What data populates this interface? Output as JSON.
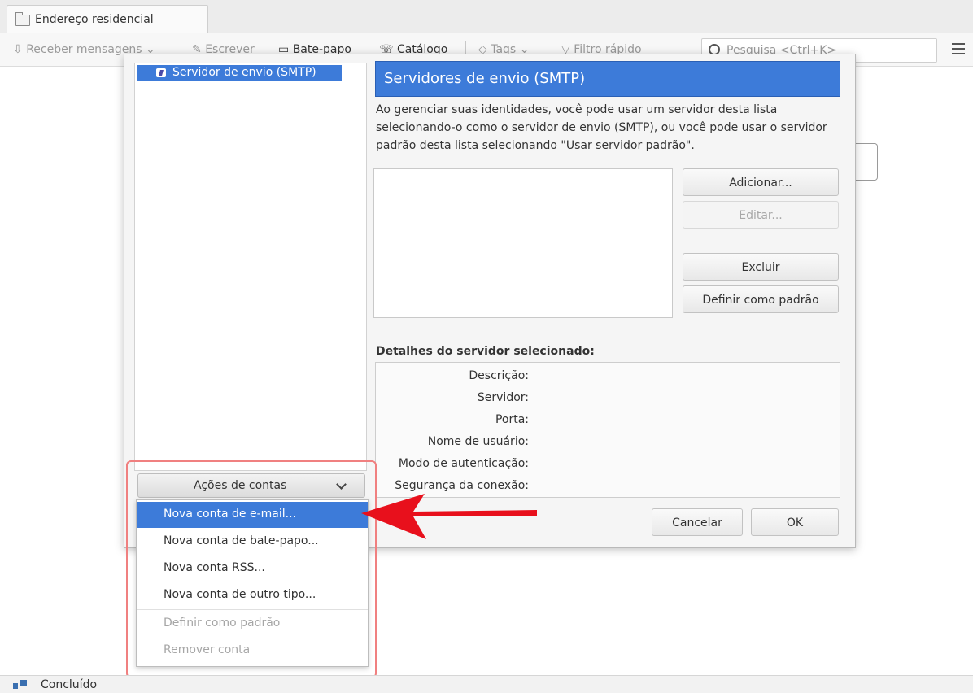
{
  "tab": {
    "title": "Endereço residencial"
  },
  "toolbar": {
    "get_messages": "Receber mensagens",
    "compose": "Escrever",
    "chat": "Bate-papo",
    "address_book": "Catálogo",
    "tags": "Tags",
    "quick_filter": "Filtro rápido",
    "search_placeholder": "Pesquisa <Ctrl+K>"
  },
  "dialog": {
    "tree_item": "Servidor de envio (SMTP)",
    "header": "Servidores de envio (SMTP)",
    "description": "Ao gerenciar suas identidades, você pode usar um servidor desta lista selecionando-o como o servidor de envio (SMTP), ou você pode usar o servidor padrão desta lista selecionando \"Usar servidor padrão\".",
    "buttons": {
      "add": "Adicionar...",
      "edit": "Editar...",
      "delete": "Excluir",
      "set_default": "Definir como padrão",
      "cancel": "Cancelar",
      "ok": "OK"
    },
    "details_title": "Detalhes do servidor selecionado:",
    "details_labels": [
      "Descrição:",
      "Servidor:",
      "Porta:",
      "Nome de usuário:",
      "Modo de autenticação:",
      "Segurança da conexão:"
    ]
  },
  "account_actions": {
    "label": "Ações de contas",
    "items": [
      {
        "label": "Nova conta de e-mail...",
        "state": "selected"
      },
      {
        "label": "Nova conta de bate-papo...",
        "state": "normal"
      },
      {
        "label": "Nova conta RSS...",
        "state": "normal"
      },
      {
        "label": "Nova conta de outro tipo...",
        "state": "normal"
      },
      {
        "label": "Definir como padrão",
        "state": "disabled"
      },
      {
        "label": "Remover conta",
        "state": "disabled"
      }
    ]
  },
  "status": {
    "text": "Concluído"
  },
  "colors": {
    "selection": "#3d7bd9",
    "arrow": "#e8101c",
    "highlight_border": "#f08080"
  }
}
